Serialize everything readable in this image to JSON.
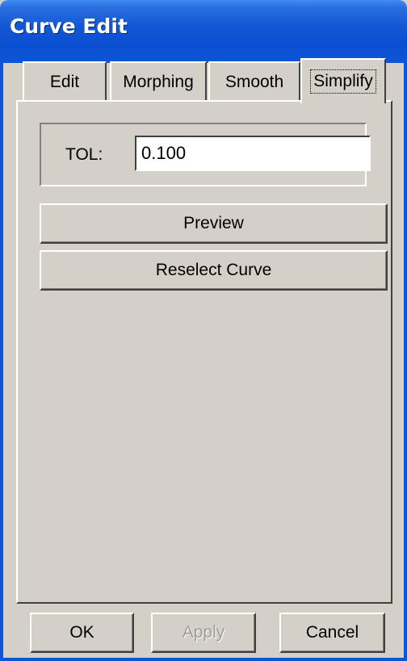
{
  "window": {
    "title": "Curve Edit"
  },
  "tabs": [
    {
      "label": "Edit",
      "active": false
    },
    {
      "label": "Morphing",
      "active": false
    },
    {
      "label": "Smooth",
      "active": false
    },
    {
      "label": "Simplify",
      "active": true
    }
  ],
  "simplify": {
    "tol_label": "TOL:",
    "tol_value": "0.100",
    "preview_label": "Preview",
    "reselect_label": "Reselect Curve"
  },
  "footer": {
    "ok_label": "OK",
    "apply_label": "Apply",
    "apply_enabled": false,
    "cancel_label": "Cancel"
  }
}
